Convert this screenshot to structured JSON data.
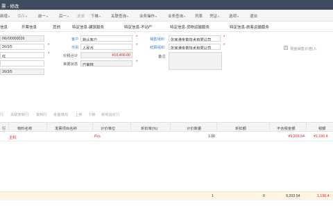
{
  "window": {
    "title": "票 - 修改"
  },
  "toolbar": {
    "items": [
      {
        "label": "新增",
        "disabled": false,
        "dropdown": true
      },
      {
        "label": "保存",
        "disabled": true,
        "dropdown": true
      },
      {
        "label": "前一",
        "disabled": false,
        "dropdown": true
      },
      {
        "label": "后一",
        "disabled": false,
        "dropdown": true
      },
      {
        "label": "选单",
        "disabled": true,
        "dropdown": false
      },
      {
        "label": "下推",
        "disabled": false,
        "dropdown": true
      },
      {
        "label": "关联查询",
        "disabled": false,
        "dropdown": true
      },
      {
        "label": "业务操作",
        "disabled": false,
        "dropdown": true
      },
      {
        "label": "业务查询",
        "disabled": false,
        "dropdown": true
      },
      {
        "label": "列表",
        "disabled": false,
        "dropdown": false
      },
      {
        "label": "凭证",
        "disabled": false,
        "dropdown": true
      },
      {
        "label": "选项",
        "disabled": false,
        "dropdown": true
      },
      {
        "label": "退出",
        "disabled": false,
        "dropdown": false
      }
    ]
  },
  "tabs": [
    "信息",
    "开票信息",
    "其他",
    "特定信息-建筑服务",
    "特定信息-不动产",
    "特定信息-货物运输服务",
    "特定信息-旅客运输服务"
  ],
  "form": {
    "billno": "INV00000026",
    "date1": "26/3/5",
    "field3": "红",
    "field4": "",
    "date2": "26/3/5",
    "customer_label": "客户",
    "customer_value": "默认客户",
    "currency_label": "币别",
    "currency_value": "人民币",
    "amount_label": "价税合计",
    "amount_value": "¥10,400.00",
    "status_label": "单据状态",
    "status_value": "已审核",
    "sales_org_label": "销售组织",
    "sales_org_value": "张家港金数技术有限公司",
    "settle_org_label": "结算组织",
    "settle_org_value": "张家港金数技术有限公司",
    "remark_label": "备注",
    "checkbox_label": "現金销售价值(入"
  },
  "entry_toolbar": [
    "行",
    "关联复制行",
    "复制行",
    "批量填充",
    "上移",
    "下移",
    "移到指定行"
  ],
  "grid": {
    "columns": [
      "行",
      "物料名称",
      "发票项目名称",
      "计价单位",
      "折扣率(%)",
      "计价数量",
      "折扣额",
      "不含税金额",
      "税额"
    ],
    "rows": [
      {
        "material": "主机",
        "invoice_item": "",
        "unit": "Pcs",
        "discount_rate": "",
        "qty": "1.00",
        "discount": "",
        "amount_ex_tax": "¥9,203.54",
        "tax": "¥1,196.4"
      }
    ]
  },
  "footer": {
    "qty_total": "1",
    "discount_total": "0",
    "amount_total": "9,203.54",
    "tax_total": "1,196.4"
  }
}
